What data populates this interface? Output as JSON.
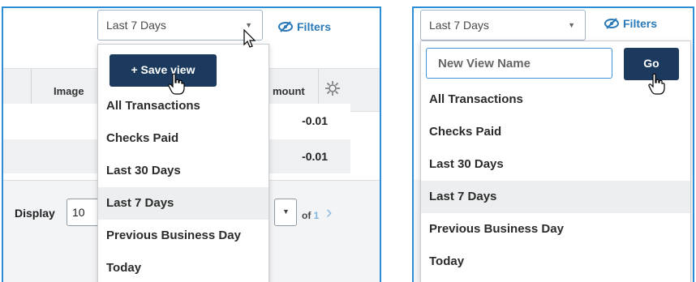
{
  "left": {
    "view_select": {
      "value": "Last 7 Days"
    },
    "filters_label": "Filters",
    "table": {
      "headers": [
        "Image",
        "mount"
      ],
      "rows": [
        {
          "amount": "-0.01"
        },
        {
          "amount": "-0.01"
        }
      ]
    },
    "pager": {
      "display_label": "Display",
      "page_size": "10",
      "of_label": "of",
      "total_pages": "1"
    },
    "menu": {
      "save_view_label": "+ Save view",
      "items": [
        "All Transactions",
        "Checks Paid",
        "Last 30 Days",
        "Last 7 Days",
        "Previous Business Day",
        "Today"
      ],
      "active_item": "Last 7 Days"
    }
  },
  "right": {
    "view_select": {
      "value": "Last 7 Days"
    },
    "filters_label": "Filters",
    "menu": {
      "new_view_placeholder": "New View Name",
      "go_label": "Go",
      "items": [
        "All Transactions",
        "Checks Paid",
        "Last 30 Days",
        "Last 7 Days",
        "Previous Business Day",
        "Today"
      ],
      "active_item": "Last 7 Days"
    }
  },
  "colors": {
    "accent": "#2c8fd6",
    "button": "#1b3a5e",
    "link": "#2a79b8"
  }
}
